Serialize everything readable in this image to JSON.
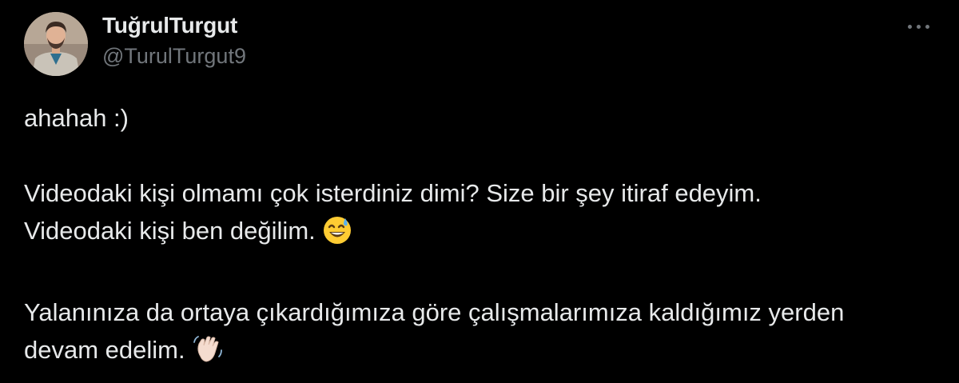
{
  "author": {
    "display_name": "TuğrulTurgut",
    "handle": "@TurulTurgut9"
  },
  "menu": {
    "more_icon": "ellipsis-icon"
  },
  "tweet": {
    "line1": "ahahah :)",
    "line2": "Videodaki kişi olmamı çok isterdiniz dimi? Size bir şey itiraf edeyim.",
    "line3": "Videodaki kişi ben değilim.",
    "line3_emoji": "grinning-face-with-sweat-emoji",
    "line4": "Yalanınıza da ortaya çıkardığımıza göre çalışmalarımıza kaldığımız yerden",
    "line5": "devam edelim.",
    "line5_emoji": "waving-hand-emoji"
  },
  "colors": {
    "background": "#000000",
    "text": "#e7e9ea",
    "secondary_text": "#71767b"
  }
}
